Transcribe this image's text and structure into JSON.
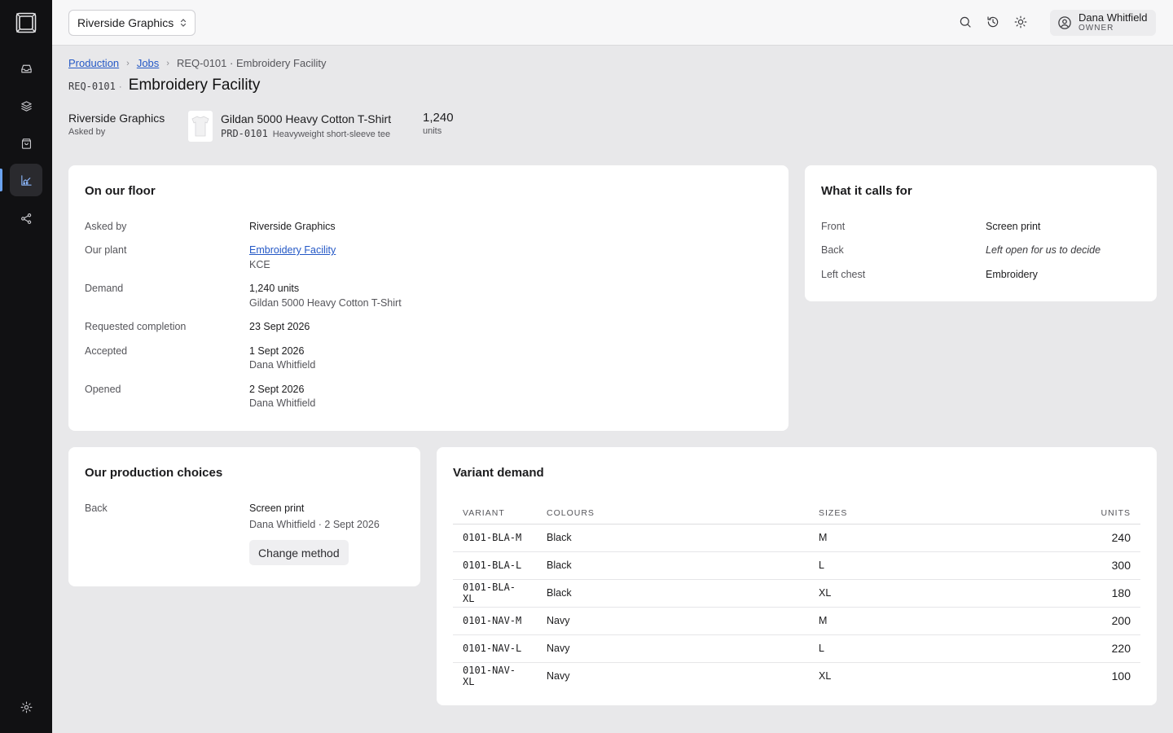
{
  "topbar": {
    "organization": "Riverside Graphics",
    "user": {
      "name": "Dana Whitfield",
      "role": "OWNER"
    }
  },
  "breadcrumb": {
    "items": [
      "Production",
      "Jobs"
    ],
    "current": "REQ-0101 · Embroidery Facility"
  },
  "header": {
    "code": "REQ-0101",
    "title": "Embroidery Facility"
  },
  "summary": {
    "requester": "Riverside Graphics",
    "requester_label": "Asked by",
    "product": {
      "name": "Gildan 5000 Heavy Cotton T-Shirt",
      "sku": "PRD-0101",
      "description": "Heavyweight short-sleeve tee"
    },
    "units": "1,240",
    "units_label": "units"
  },
  "floor": {
    "title": "On our floor",
    "rows": [
      {
        "label": "Asked by",
        "value": "Riverside Graphics",
        "sub": ""
      },
      {
        "label": "Our plant",
        "value": "Embroidery Facility",
        "sub": "KCE"
      },
      {
        "label": "Demand",
        "value": "1,240 units",
        "sub": "Gildan 5000 Heavy Cotton T-Shirt"
      },
      {
        "label": "Requested completion",
        "value": "23 Sept 2026",
        "sub": ""
      },
      {
        "label": "Accepted",
        "value": "1 Sept 2026",
        "sub": "Dana Whitfield"
      },
      {
        "label": "Opened",
        "value": "2 Sept 2026",
        "sub": "Dana Whitfield"
      }
    ]
  },
  "calls_for": {
    "title": "What it calls for",
    "rows": [
      {
        "label": "Front",
        "value": "Screen print"
      },
      {
        "label": "Back",
        "value": "Left open for us to decide"
      },
      {
        "label": "Left chest",
        "value": "Embroidery"
      }
    ]
  },
  "choices": {
    "title": "Our production choices",
    "label": "Back",
    "value": "Screen print",
    "meta": "Dana Whitfield · 2 Sept 2026",
    "button": "Change method"
  },
  "variants": {
    "title": "Variant demand",
    "columns": [
      "VARIANT",
      "COLOURS",
      "SIZES",
      "UNITS"
    ],
    "rows": [
      {
        "variant": "0101-BLA-M",
        "colour": "Black",
        "size": "M",
        "units": "240"
      },
      {
        "variant": "0101-BLA-L",
        "colour": "Black",
        "size": "L",
        "units": "300"
      },
      {
        "variant": "0101-BLA-XL",
        "colour": "Black",
        "size": "XL",
        "units": "180"
      },
      {
        "variant": "0101-NAV-M",
        "colour": "Navy",
        "size": "M",
        "units": "200"
      },
      {
        "variant": "0101-NAV-L",
        "colour": "Navy",
        "size": "L",
        "units": "220"
      },
      {
        "variant": "0101-NAV-XL",
        "colour": "Navy",
        "size": "XL",
        "units": "100"
      }
    ]
  },
  "colors": {
    "sidebar_bg": "#111113",
    "accent": "#2458c6",
    "active_nav": "#8ab4f8"
  },
  "icons": {
    "nav": [
      "inbox-icon",
      "layers-icon",
      "package-icon",
      "chart-icon",
      "share-icon"
    ],
    "settings": "gear-icon",
    "top": [
      "search-icon",
      "history-icon",
      "sun-icon"
    ]
  }
}
